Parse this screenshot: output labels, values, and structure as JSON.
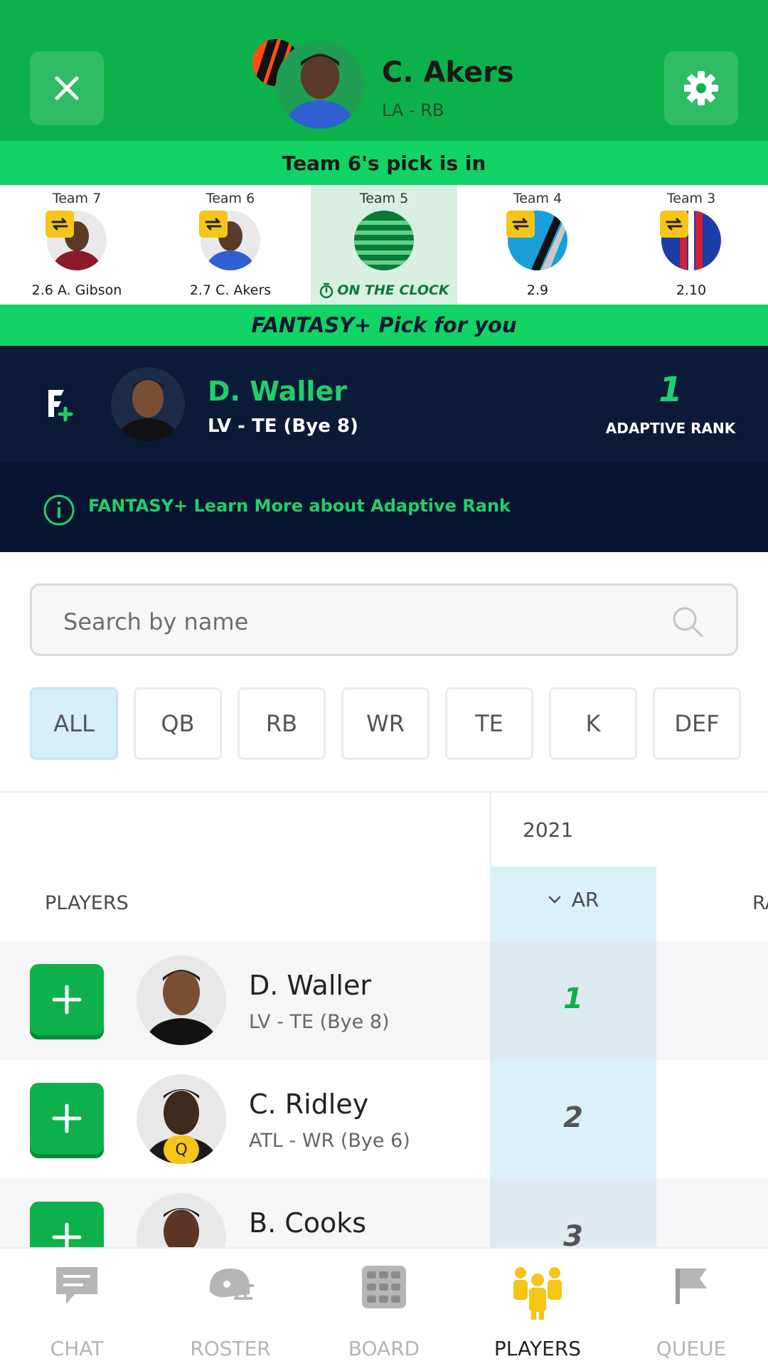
{
  "header": {
    "player_name": "C. Akers",
    "player_sub": "LA - RB"
  },
  "pick_banner": "Team 6's pick is in",
  "draft_order": [
    {
      "team": "Team 7",
      "pick": "2.6 A. Gibson",
      "jersey": "#8b1a2b"
    },
    {
      "team": "Team 6",
      "pick": "2.7 C. Akers",
      "jersey": "#2f5fd0"
    },
    {
      "team": "Team 5",
      "status": "ON THE CLOCK"
    },
    {
      "team": "Team 4",
      "pick": "2.9"
    },
    {
      "team": "Team 3",
      "pick": "2.10"
    }
  ],
  "fantasy_banner": "FANTASY+ Pick for you",
  "recommendation": {
    "name": "D. Waller",
    "sub": "LV - TE (Bye 8)",
    "rank": "1",
    "rank_label": "ADAPTIVE RANK"
  },
  "learn_more": "FANTASY+ Learn More about Adaptive Rank",
  "search": {
    "placeholder": "Search by name"
  },
  "filters": [
    "ALL",
    "QB",
    "RB",
    "WR",
    "TE",
    "K",
    "DEF"
  ],
  "table": {
    "season": "2021",
    "col_players": "PLAYERS",
    "col_ar": "AR",
    "col_next": "RA",
    "rows": [
      {
        "name": "D. Waller",
        "sub": "LV - TE (Bye 8)",
        "rank": "1"
      },
      {
        "name": "C. Ridley",
        "sub": "ATL - WR (Bye 6)",
        "rank": "2",
        "badge": "Q"
      },
      {
        "name": "B. Cooks",
        "sub": "",
        "rank": "3"
      }
    ]
  },
  "nav": [
    {
      "label": "CHAT",
      "icon": "chat-icon"
    },
    {
      "label": "ROSTER",
      "icon": "helmet-icon"
    },
    {
      "label": "BOARD",
      "icon": "board-icon"
    },
    {
      "label": "PLAYERS",
      "icon": "players-icon",
      "active": true
    },
    {
      "label": "QUEUE",
      "icon": "flag-icon"
    }
  ],
  "colors": {
    "brand_green": "#0db14b",
    "bright_green": "#12d466",
    "navy": "#0b1a36",
    "highlight_blue": "#d9f1f7",
    "active_yellow": "#f5c518"
  }
}
